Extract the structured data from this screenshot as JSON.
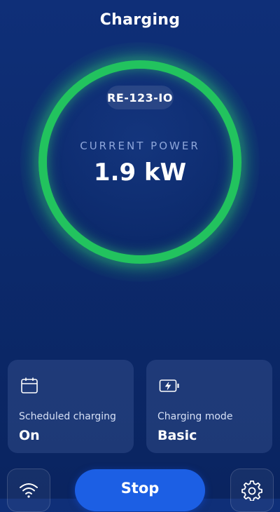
{
  "header": {
    "title": "Charging"
  },
  "charger": {
    "device_id": "RE-123-IO",
    "power_label": "CURRENT POWER",
    "power_value": "1.9 kW"
  },
  "cards": {
    "scheduled": {
      "label": "Scheduled charging",
      "value": "On",
      "icon": "calendar-icon"
    },
    "mode": {
      "label": "Charging mode",
      "value": "Basic",
      "icon": "battery-charging-icon"
    }
  },
  "controls": {
    "stop_label": "Stop",
    "wifi_icon": "wifi-icon",
    "settings_icon": "gear-icon"
  },
  "colors": {
    "ring": "#22c35e",
    "accent": "#1c5fe4",
    "background": "#0c2a6c"
  }
}
